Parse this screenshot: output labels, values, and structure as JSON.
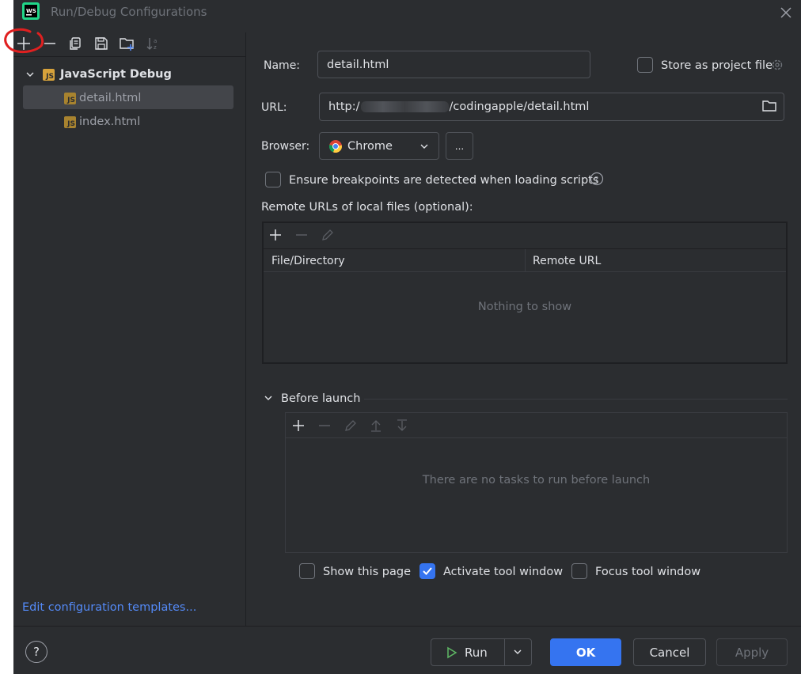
{
  "window": {
    "title": "Run/Debug Configurations",
    "logo_text": "WS"
  },
  "toolbar": {
    "add_icon": "plus-icon",
    "remove_icon": "minus-icon",
    "copy_icon": "copy-icon",
    "save_icon": "save-icon",
    "folder_icon": "new-folder-icon",
    "sort_icon": "sort-alpha-icon"
  },
  "tree": {
    "group_label": "JavaScript Debug",
    "badge": "JS",
    "items": [
      {
        "label": "detail.html"
      },
      {
        "label": "index.html"
      }
    ]
  },
  "sidebar": {
    "edit_templates_link": "Edit configuration templates..."
  },
  "form": {
    "name_label": "Name:",
    "name_value": "detail.html",
    "store_label": "Store as project file",
    "url_label": "URL:",
    "url_prefix": "http:/",
    "url_suffix": "/codingapple/detail.html",
    "browser_label": "Browser:",
    "browser_value": "Chrome",
    "browse_dots": "...",
    "ensure_label": "Ensure breakpoints are detected when loading scripts",
    "remote_urls_label": "Remote URLs of local files (optional):",
    "col_file": "File/Directory",
    "col_remote": "Remote URL",
    "empty_text": "Nothing to show"
  },
  "before_launch": {
    "label": "Before launch",
    "empty_text": "There are no tasks to run before launch",
    "show_page": "Show this page",
    "activate_tool": "Activate tool window",
    "focus_tool": "Focus tool window",
    "activate_checked": true
  },
  "footer": {
    "help": "?",
    "run": "Run",
    "ok": "OK",
    "cancel": "Cancel",
    "apply": "Apply"
  },
  "colors": {
    "accent": "#3574f0",
    "annotation": "#e02020",
    "background": "#2b2d30"
  }
}
